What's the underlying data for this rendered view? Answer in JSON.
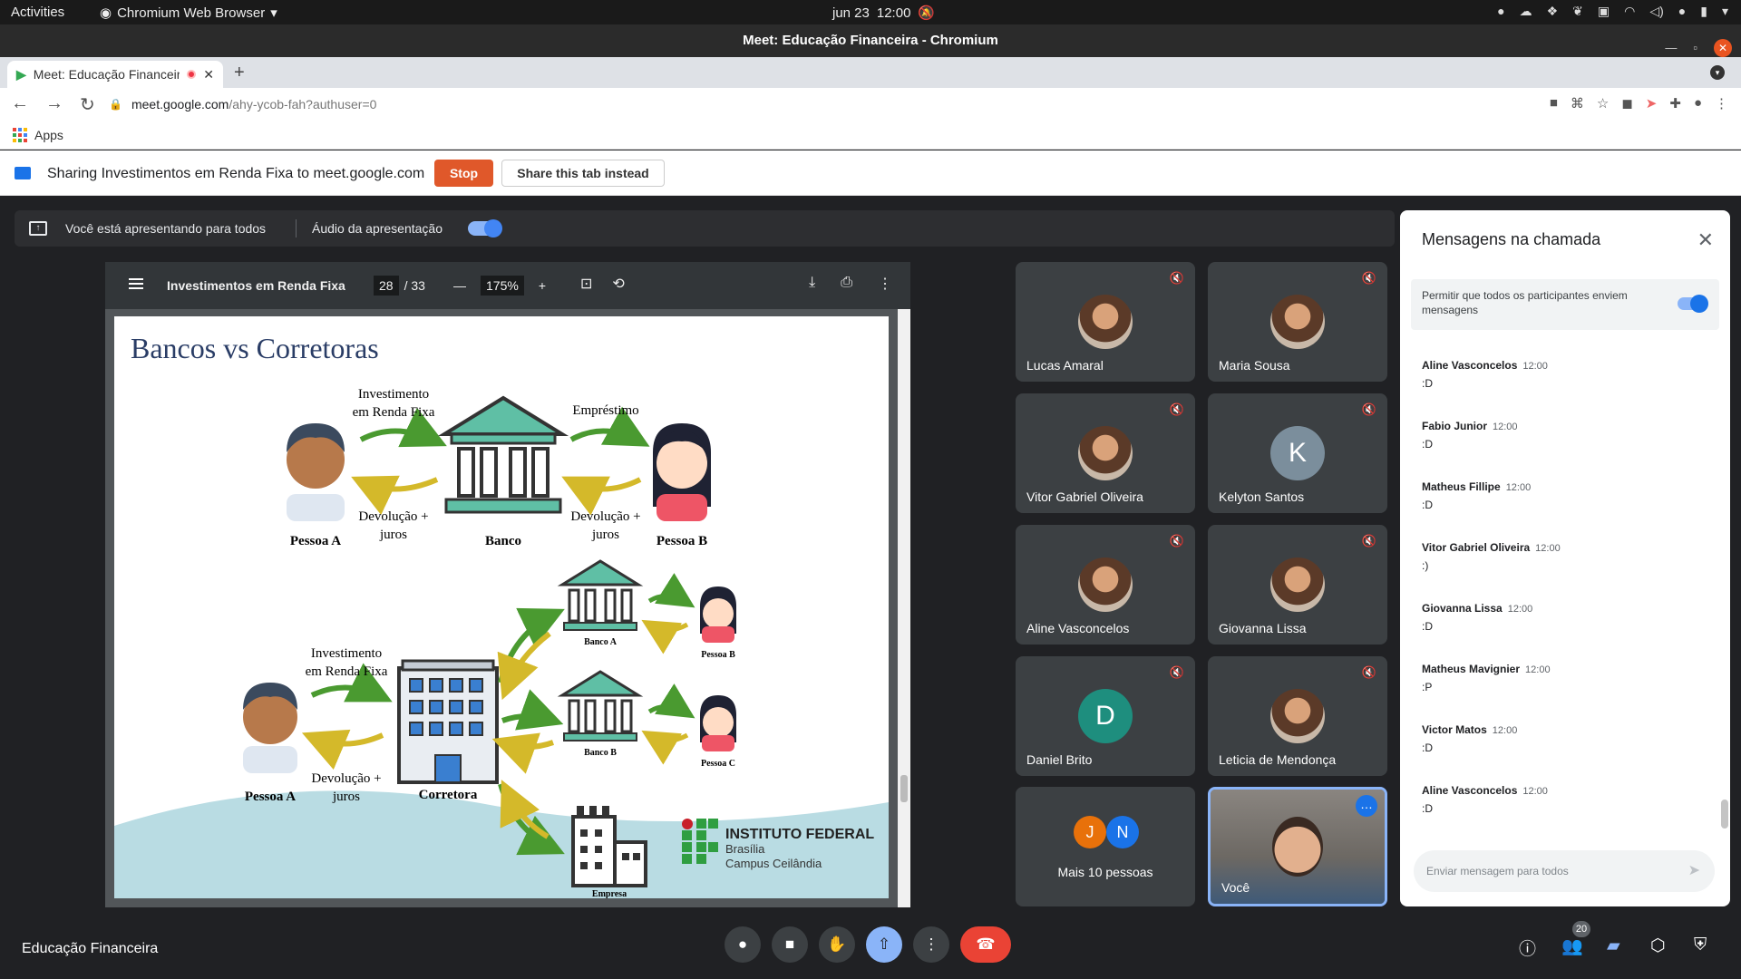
{
  "topbar": {
    "activities": "Activities",
    "app_name": "Chromium Web Browser",
    "date": "jun 23",
    "time": "12:00"
  },
  "window": {
    "title": "Meet: Educação Financeira - Chromium"
  },
  "tab": {
    "title": "Meet: Educação Financeira"
  },
  "address": {
    "host": "meet.google.com",
    "path": "/ahy-ycob-fah?authuser=0"
  },
  "bookmarks": {
    "apps": "Apps"
  },
  "sharebar": {
    "text": "Sharing Investimentos em Renda Fixa to meet.google.com",
    "stop": "Stop",
    "share_instead": "Share this tab instead"
  },
  "presenting": {
    "text": "Você está apresentando para todos",
    "audio": "Áudio da apresentação"
  },
  "pdf": {
    "title": "Investimentos em Renda Fixa",
    "page": "28",
    "total": "/ 33",
    "zoom": "175%"
  },
  "slide": {
    "title": "Bancos vs Corretoras",
    "top": {
      "invest": [
        "Investimento",
        "em Renda Fixa"
      ],
      "loan": "Empréstimo",
      "return1": [
        "Devolução +",
        "juros"
      ],
      "return2": [
        "Devolução +",
        "juros"
      ],
      "person_a": "Pessoa A",
      "bank": "Banco",
      "person_b": "Pessoa B"
    },
    "bottom": {
      "invest": [
        "Investimento",
        "em Renda Fixa"
      ],
      "return": [
        "Devolução +",
        "juros"
      ],
      "person_a": "Pessoa A",
      "broker": "Corretora",
      "bank_a": "Banco A",
      "bank_b": "Banco B",
      "person_b": "Pessoa B",
      "person_c": "Pessoa C",
      "company": "Empresa"
    },
    "logo": {
      "name": "INSTITUTO FEDERAL",
      "city": "Brasília",
      "campus": "Campus Ceilândia"
    }
  },
  "participants": [
    {
      "name": "Lucas Amaral",
      "type": "photo"
    },
    {
      "name": "Maria Sousa",
      "type": "photo"
    },
    {
      "name": "Vitor Gabriel Oliveira",
      "type": "photo"
    },
    {
      "name": "Kelyton Santos",
      "type": "letter",
      "letter": "K",
      "color": "#7b8e9c"
    },
    {
      "name": "Aline Vasconcelos",
      "type": "photo"
    },
    {
      "name": "Giovanna Lissa",
      "type": "photo"
    },
    {
      "name": "Daniel Brito",
      "type": "letter",
      "letter": "D",
      "color": "#1e8e7e"
    },
    {
      "name": "Leticia de Mendonça",
      "type": "photo"
    }
  ],
  "more": {
    "label": "Mais 10 pessoas",
    "a1": "J",
    "a2": "N",
    "a1_color": "#e8710a",
    "a2_color": "#1a73e8"
  },
  "self": {
    "name": "Você"
  },
  "chat": {
    "title": "Mensagens na chamada",
    "allow_text": "Permitir que todos os participantes enviem mensagens",
    "messages": [
      {
        "from": "Aline Vasconcelos",
        "time": "12:00",
        "text": ":D"
      },
      {
        "from": "Fabio Junior",
        "time": "12:00",
        "text": ":D"
      },
      {
        "from": "Matheus Fillipe",
        "time": "12:00",
        "text": ":D"
      },
      {
        "from": "Vitor Gabriel Oliveira",
        "time": "12:00",
        "text": ":)"
      },
      {
        "from": "Giovanna Lissa",
        "time": "12:00",
        "text": ":D"
      },
      {
        "from": "Matheus Mavignier",
        "time": "12:00",
        "text": ":P"
      },
      {
        "from": "Victor Matos",
        "time": "12:00",
        "text": ":D"
      },
      {
        "from": "Aline Vasconcelos",
        "time": "12:00",
        "text": ":D"
      }
    ],
    "placeholder": "Enviar mensagem para todos"
  },
  "bottom": {
    "meeting_name": "Educação Financeira",
    "participants_count": "20"
  }
}
